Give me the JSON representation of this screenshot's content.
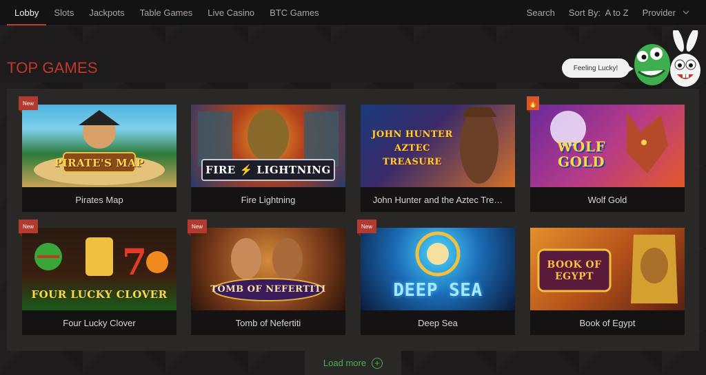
{
  "nav": {
    "items": [
      "Lobby",
      "Slots",
      "Jackpots",
      "Table Games",
      "Live Casino",
      "BTC Games"
    ],
    "active": "Lobby"
  },
  "controls": {
    "search": "Search",
    "sort": "Sort By:  A to Z",
    "provider": "Provider"
  },
  "section_title": "TOP GAMES",
  "lucky": "Feeling Lucky!",
  "games": [
    {
      "name": "Pirates Map",
      "art": "PIRATE'S MAP",
      "badge": "New"
    },
    {
      "name": "Fire Lightning",
      "art": "FIRE ⚡ LIGHTNING",
      "badge": ""
    },
    {
      "name": "John Hunter and the Aztec Tre…",
      "art": "JOHN HUNTER AZTEC TREASURE",
      "badge": ""
    },
    {
      "name": "Wolf Gold",
      "art": "WOLF GOLD",
      "badge": "hot"
    },
    {
      "name": "Four Lucky Clover",
      "art": "FOUR LUCKY CLOVER",
      "badge": "New"
    },
    {
      "name": "Tomb of Nefertiti",
      "art": "TOMB OF NEFERTITI",
      "badge": "New"
    },
    {
      "name": "Deep Sea",
      "art": "DEEP SEA",
      "badge": "New"
    },
    {
      "name": "Book of Egypt",
      "art": "BOOK OF EGYPT",
      "badge": ""
    }
  ],
  "load_more": "Load more",
  "colors": {
    "accent": "#c0392b",
    "green": "#4caf50",
    "panel": "#2a2727"
  }
}
